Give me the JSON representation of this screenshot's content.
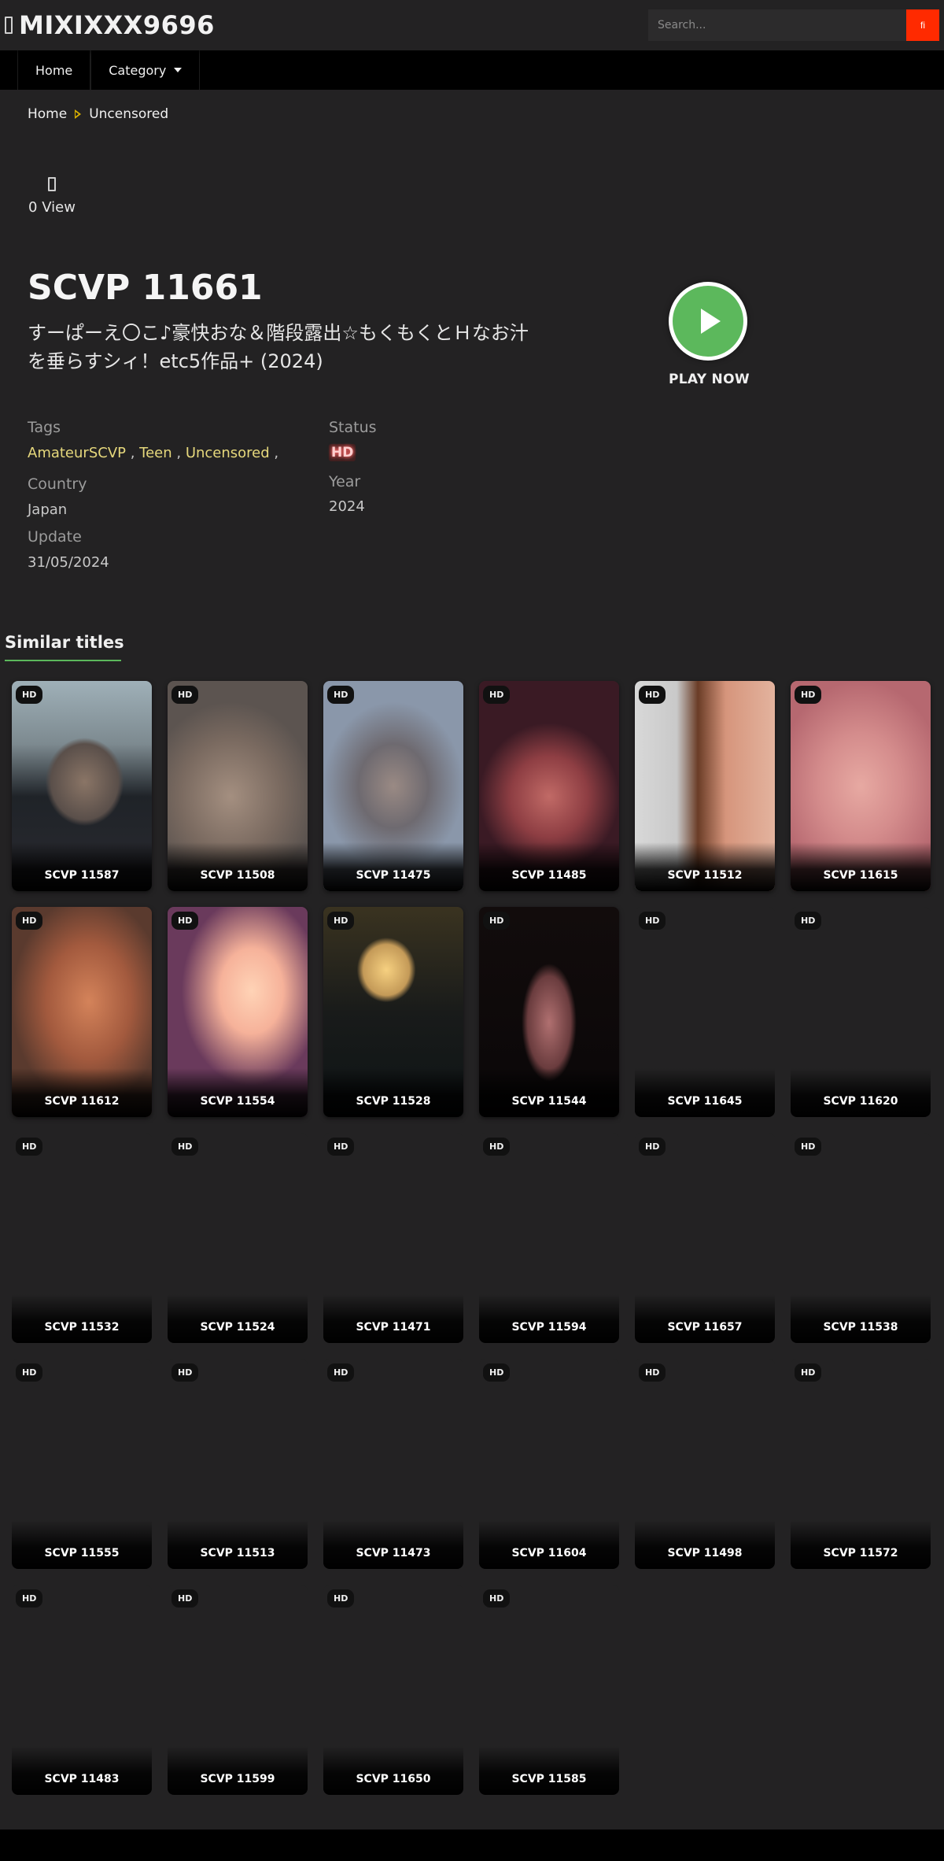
{
  "header": {
    "site_name": "MIXIXXX9696",
    "search_placeholder": "Search...",
    "search_button_glyph": "fi"
  },
  "nav": {
    "items": [
      {
        "label": "Home"
      },
      {
        "label": "Category"
      }
    ]
  },
  "breadcrumb": {
    "home": "Home",
    "current": "Uncensored"
  },
  "views": {
    "text": "0 View"
  },
  "video": {
    "code": "SCVP 11661",
    "title": "すーぱーえ〇こ♪豪快おな＆階段露出☆もくもくとＨなお汁を垂らすシィ！etc5作品+ (2024)",
    "play_label": "PLAY NOW"
  },
  "meta": {
    "tags_label": "Tags",
    "tags": [
      "AmateurSCVP",
      "Teen",
      "Uncensored"
    ],
    "status_label": "Status",
    "status": "HD",
    "country_label": "Country",
    "country": "Japan",
    "year_label": "Year",
    "year": "2024",
    "update_label": "Update",
    "update": "31/05/2024"
  },
  "similar": {
    "heading": "Similar titles",
    "badge": "HD",
    "items": [
      "SCVP 11587",
      "SCVP 11508",
      "SCVP 11475",
      "SCVP 11485",
      "SCVP 11512",
      "SCVP 11615",
      "SCVP 11612",
      "SCVP 11554",
      "SCVP 11528",
      "SCVP 11544",
      "SCVP 11645",
      "SCVP 11620",
      "SCVP 11532",
      "SCVP 11524",
      "SCVP 11471",
      "SCVP 11594",
      "SCVP 11657",
      "SCVP 11538",
      "SCVP 11555",
      "SCVP 11513",
      "SCVP 11473",
      "SCVP 11604",
      "SCVP 11498",
      "SCVP 11572",
      "SCVP 11483",
      "SCVP 11599",
      "SCVP 11650",
      "SCVP 11585"
    ]
  },
  "colors": {
    "accent_green": "#5cb85c",
    "search_button": "#ff2a00",
    "tag_color": "#e6d87c",
    "background": "#232223"
  }
}
